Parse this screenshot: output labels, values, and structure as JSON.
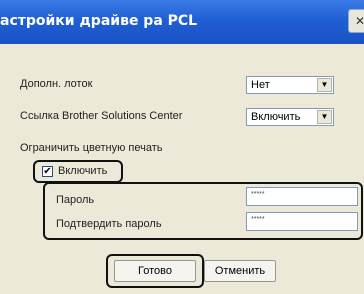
{
  "window": {
    "title": "астройки драйве ра PCL",
    "close_glyph": "✕"
  },
  "settings": {
    "extra_tray": {
      "label": "Дополн. лоток",
      "value": "Нет"
    },
    "brother_link": {
      "label": "Ссылка Brother Solutions Center",
      "value": "Включить"
    },
    "restrict_color": {
      "label": "Ограничить цветную печать",
      "enable_label": "Включить",
      "checked": true,
      "check_glyph": "✔"
    },
    "password": {
      "label": "Пароль",
      "value": "*****"
    },
    "confirm_password": {
      "label": "Подтвердить пароль",
      "value": "*****"
    }
  },
  "buttons": {
    "ok": "Готово",
    "cancel": "Отменить"
  },
  "icons": {
    "dropdown": "▼"
  },
  "colors": {
    "titlebar": "#1f5fd4",
    "dialog": "#ece9d8"
  }
}
